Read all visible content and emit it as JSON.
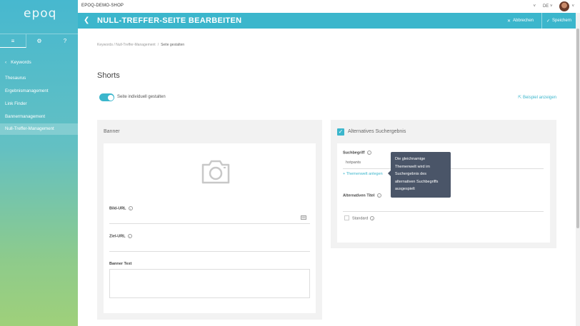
{
  "app": {
    "logo": "epoq",
    "shop_name": "EPOQ-DEMO-SHOP",
    "language": "DE",
    "accent_color": "#3bb6cc"
  },
  "sidebar": {
    "tabs": [
      {
        "icon": "menu-icon",
        "glyph": "≡"
      },
      {
        "icon": "gear-icon",
        "glyph": "⚙"
      },
      {
        "icon": "help-icon",
        "glyph": "?"
      }
    ],
    "back_label": "Keywords",
    "items": [
      {
        "label": "Thesaurus"
      },
      {
        "label": "Ergebnismanagement"
      },
      {
        "label": "Link Finder"
      },
      {
        "label": "Bannermanagement"
      },
      {
        "label": "Null-Treffer-Management"
      }
    ]
  },
  "header": {
    "title": "NULL-TREFFER-SEITE BEARBEITEN",
    "cancel_label": "Abbrechen",
    "save_label": "Speichern"
  },
  "breadcrumb": {
    "parent": "Keywords / Null-Treffer-Management",
    "separator": "/",
    "current": "Seite gestalten"
  },
  "page": {
    "title": "Shorts",
    "toggle_label": "Seite individuell gestalten",
    "toggle_on": true,
    "example_link": "Beispiel anzeigen"
  },
  "banner_panel": {
    "title": "Banner",
    "image_url_label": "Bild-URL",
    "target_url_label": "Ziel-URL",
    "banner_text_label": "Banner Text"
  },
  "alt_panel": {
    "title": "Alternatives Suchergebnis",
    "checked": true,
    "search_term_label": "Suchbegriff",
    "search_term_value": "hotpants",
    "add_theme_link": "Themenwelt anlegen",
    "alt_title_label": "Alternativen Titel",
    "standard_label": "Standard"
  },
  "tooltip": {
    "lines": [
      "Die gleichnamige",
      "Themenwelt wird im",
      "Suchergebnis des",
      "alternativen Suchbegriffs",
      "ausgespielt"
    ]
  }
}
